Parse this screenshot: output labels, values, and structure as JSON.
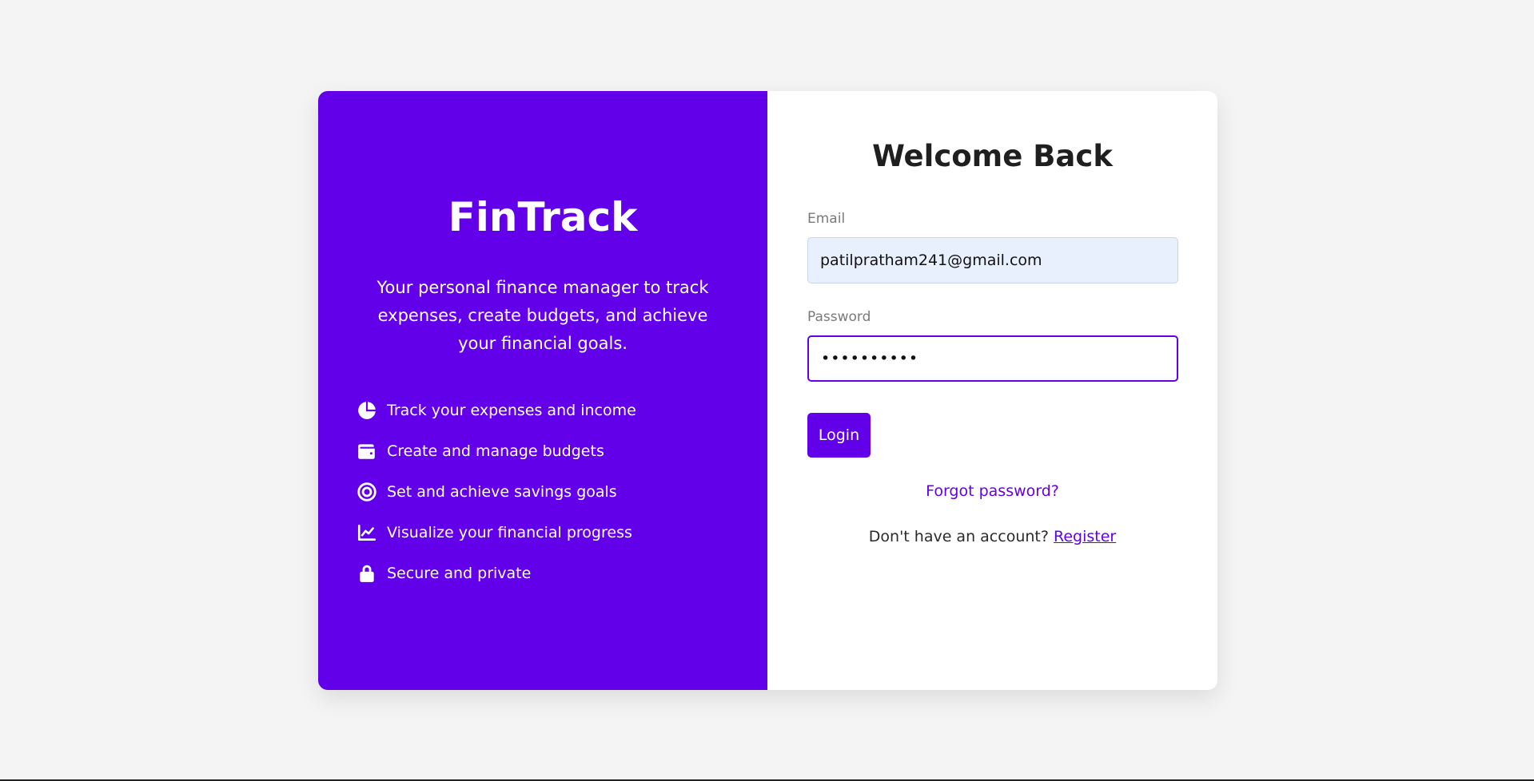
{
  "brand": {
    "name": "FinTrack",
    "tagline": "Your personal finance manager to track expenses, create budgets, and achieve your financial goals."
  },
  "features": [
    {
      "icon": "pie-chart-icon",
      "label": "Track your expenses and income"
    },
    {
      "icon": "wallet-icon",
      "label": "Create and manage budgets"
    },
    {
      "icon": "target-icon",
      "label": "Set and achieve savings goals"
    },
    {
      "icon": "line-chart-icon",
      "label": "Visualize your financial progress"
    },
    {
      "icon": "lock-icon",
      "label": "Secure and private"
    }
  ],
  "login": {
    "title": "Welcome Back",
    "email_label": "Email",
    "email_value": "patilpratham241@gmail.com",
    "password_label": "Password",
    "password_value": "••••••••••",
    "submit_label": "Login",
    "forgot_label": "Forgot password?",
    "register_prompt": "Don't have an account? ",
    "register_label": "Register"
  },
  "colors": {
    "accent": "#6200ea",
    "background": "#f4f4f4",
    "email_field_bg": "#e8f0fe"
  }
}
